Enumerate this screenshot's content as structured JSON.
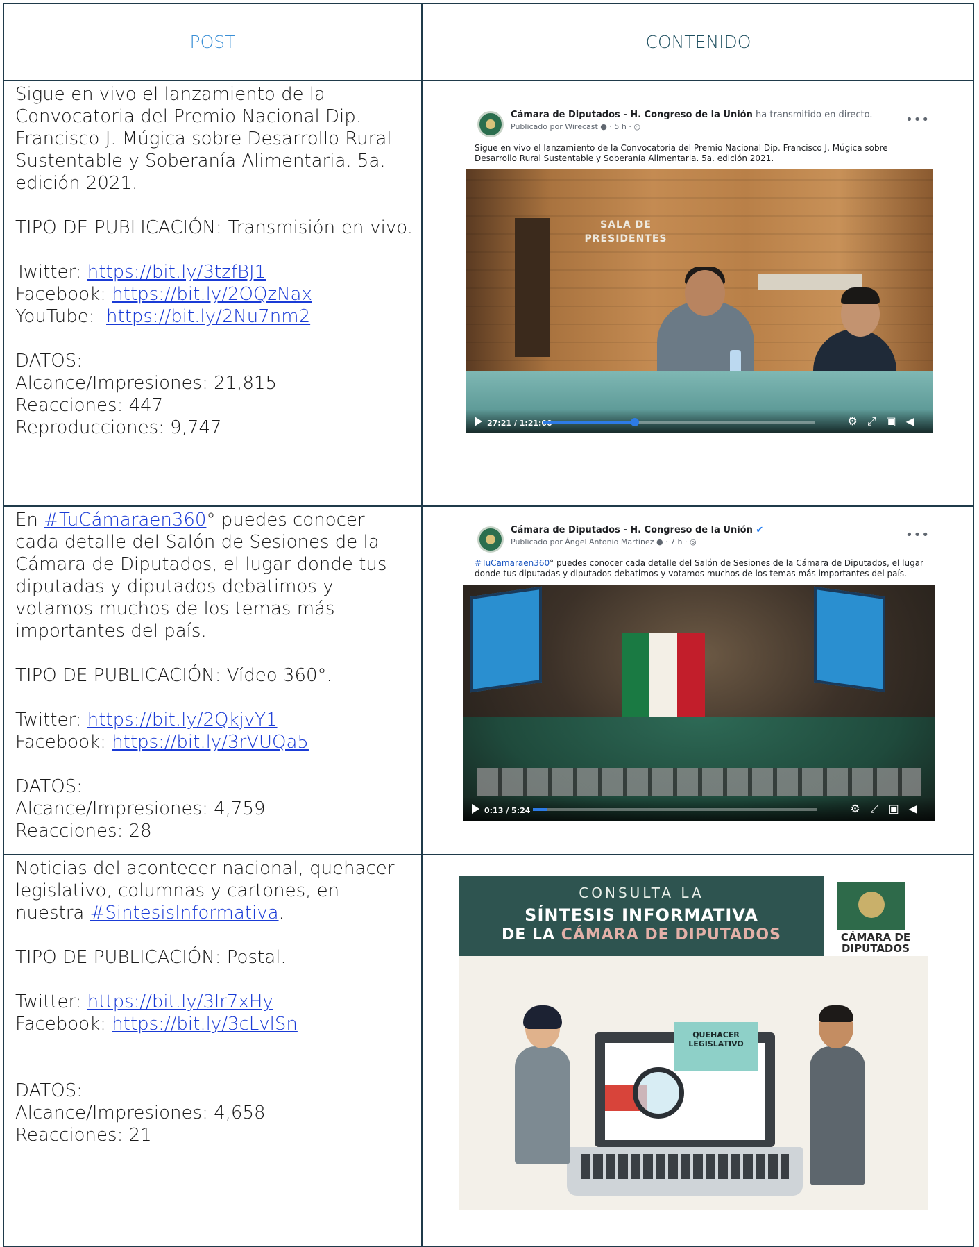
{
  "header": {
    "post": "POST",
    "contenido": "CONTENIDO"
  },
  "rows": [
    {
      "text": "Sigue en vivo el lanzamiento de la Convocatoria del Premio Nacional  Dip. Francisco J. Múgica sobre Desarrollo Rural Sustentable y Soberanía Alimentaria. 5a. edición 2021.",
      "tipo": "TIPO DE PUBLICACIÓN: Transmisión en vivo.",
      "links": [
        {
          "label": "Twitter: ",
          "url": "https://bit.ly/3tzfBJ1"
        },
        {
          "label": "Facebook: ",
          "url": "https://bit.ly/2OQzNax"
        },
        {
          "label": "YouTube:  ",
          "url": "https://bit.ly/2Nu7nm2"
        }
      ],
      "datos_title": "DATOS:",
      "datos": [
        "Alcance/Impresiones: 21,815",
        "Reacciones: 447",
        "Reproducciones: 9,747"
      ],
      "fb": {
        "page_name": "Cámara de Diputados - H. Congreso de la Unión",
        "action": " ha transmitido en directo.",
        "sub": "Publicado por Wirecast ● · 5 h · ◎",
        "desc": "Sigue en vivo el lanzamiento de la Convocatoria del Premio Nacional Dip. Francisco J. Múgica sobre Desarrollo Rural Sustentable y Soberanía Alimentaria. 5a. edición 2021.",
        "video_label": "SALA DE PRESIDENTES",
        "time": "27:21 / 1:21:00",
        "progress": 0.34
      }
    },
    {
      "text_prefix": "En ",
      "hashtag": "#TuCámaraen360",
      "text_suffix": "° puedes conocer cada detalle del Salón de Sesiones de la Cámara de Diputados, el lugar donde tus diputadas y diputados debatimos y votamos muchos de los temas más importantes del país.",
      "tipo": "TIPO DE PUBLICACIÓN: Vídeo 360°.",
      "links": [
        {
          "label": "Twitter: ",
          "url": "https://bit.ly/2QkjvY1"
        },
        {
          "label": "Facebook: ",
          "url": "https://bit.ly/3rVUQa5"
        }
      ],
      "datos_title": "DATOS:",
      "datos": [
        "Alcance/Impresiones: 4,759",
        "Reacciones: 28"
      ],
      "fb": {
        "page_name": "Cámara de Diputados - H. Congreso de la Unión",
        "sub": "Publicado por Ángel Antonio Martínez ● · 7 h · ◎",
        "desc_hashtag": "#TuCamaraen360",
        "desc": "° puedes conocer cada detalle del Salón de Sesiones de la Cámara de Diputados, el lugar donde tus diputadas y diputados debatimos y votamos muchos de los temas más importantes del país.",
        "time": "0:13 / 5:24",
        "progress": 0.05
      }
    },
    {
      "text": "Noticias del acontecer nacional, quehacer legislativo, columnas y cartones, en nuestra ",
      "hashtag": "#SintesisInformativa",
      "text_end": ".",
      "tipo": "TIPO DE PUBLICACIÓN: Postal.",
      "links": [
        {
          "label": "Twitter: ",
          "url": "https://bit.ly/3lr7xHy"
        },
        {
          "label": "Facebook: ",
          "url": "https://bit.ly/3cLvlSn"
        }
      ],
      "datos_title": "DATOS:",
      "datos": [
        "Alcance/Impresiones: 4,658",
        "Reacciones: 21"
      ],
      "postal": {
        "line1": "CONSULTA LA",
        "line2": "SÍNTESIS INFORMATIVA",
        "line3_a": "DE LA ",
        "line3_b": "CÁMARA DE DIPUTADOS",
        "logo": "CÁMARA DE DIPUTADOS",
        "bubble": "QUEHACER LEGISLATIVO"
      }
    }
  ]
}
